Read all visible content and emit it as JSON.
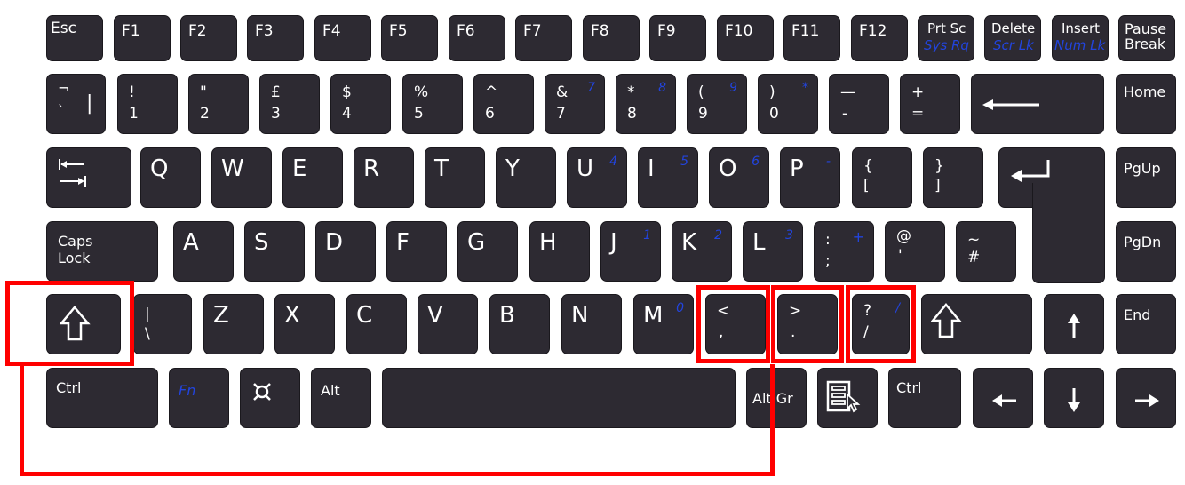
{
  "keyboard": {
    "row0": {
      "esc": "Esc",
      "f1": "F1",
      "f2": "F2",
      "f3": "F3",
      "f4": "F4",
      "f5": "F5",
      "f6": "F6",
      "f7": "F7",
      "f8": "F8",
      "f9": "F9",
      "f10": "F10",
      "f11": "F11",
      "f12": "F12",
      "prtsc": {
        "main": "Prt Sc",
        "alt": "Sys Rq"
      },
      "delete": {
        "main": "Delete",
        "alt": "Scr Lk"
      },
      "insert": {
        "main": "Insert",
        "alt": "Num Lk"
      },
      "pause": {
        "line1": "Pause",
        "line2": "Break"
      }
    },
    "row1": {
      "backtick": {
        "top": "¬",
        "bot": "`",
        "right": "|"
      },
      "k1": {
        "top": "!",
        "bot": "1"
      },
      "k2": {
        "top": "\"",
        "bot": "2"
      },
      "k3": {
        "top": "£",
        "bot": "3"
      },
      "k4": {
        "top": "$",
        "bot": "4"
      },
      "k5": {
        "top": "%",
        "bot": "5"
      },
      "k6": {
        "top": "^",
        "bot": "6"
      },
      "k7": {
        "top": "&",
        "bot": "7",
        "numpad": "7"
      },
      "k8": {
        "top": "*",
        "bot": "8",
        "numpad": "8"
      },
      "k9": {
        "top": "(",
        "bot": "9",
        "numpad": "9"
      },
      "k0": {
        "top": ")",
        "bot": "0",
        "numpad": "*"
      },
      "minus": {
        "top": "—",
        "bot": "-"
      },
      "equals": {
        "top": "+",
        "bot": "="
      },
      "home": "Home"
    },
    "row2": {
      "q": "Q",
      "w": "W",
      "e": "E",
      "r": "R",
      "t": "T",
      "y": "Y",
      "u": {
        "main": "U",
        "numpad": "4"
      },
      "i": {
        "main": "I",
        "numpad": "5"
      },
      "o": {
        "main": "O",
        "numpad": "6"
      },
      "p": {
        "main": "P",
        "numpad": "-"
      },
      "lbracket": {
        "top": "{",
        "bot": "["
      },
      "rbracket": {
        "top": "}",
        "bot": "]"
      },
      "pgup": "PgUp"
    },
    "row3": {
      "capslock": {
        "line1": "Caps",
        "line2": "Lock"
      },
      "a": "A",
      "s": "S",
      "d": "D",
      "f": "F",
      "g": "G",
      "h": "H",
      "j": {
        "main": "J",
        "numpad": "1"
      },
      "k": {
        "main": "K",
        "numpad": "2"
      },
      "l": {
        "main": "L",
        "numpad": "3"
      },
      "semicolon": {
        "top": ":",
        "bot": ";",
        "numpad": "+"
      },
      "quote": {
        "top": "@",
        "bot": "'"
      },
      "hash": {
        "top": "~",
        "bot": "#"
      },
      "pgdn": "PgDn"
    },
    "row4": {
      "backslash": {
        "top": "|",
        "bot": "\\"
      },
      "z": "Z",
      "x": "X",
      "c": "C",
      "v": "V",
      "b": "B",
      "n": "N",
      "m": {
        "main": "M",
        "numpad": "0"
      },
      "comma": {
        "top": "<",
        "bot": ","
      },
      "period": {
        "top": ">",
        "bot": "."
      },
      "slash": {
        "top": "?",
        "bot": "/",
        "numpad": "/"
      },
      "end": "End"
    },
    "row5": {
      "ctrl_left": "Ctrl",
      "fn": "Fn",
      "altgr": "Alt Gr",
      "alt": "Alt",
      "ctrl_right": "Ctrl"
    }
  },
  "highlight_color": "#ff0000",
  "numpad_label_color": "#2244dd"
}
